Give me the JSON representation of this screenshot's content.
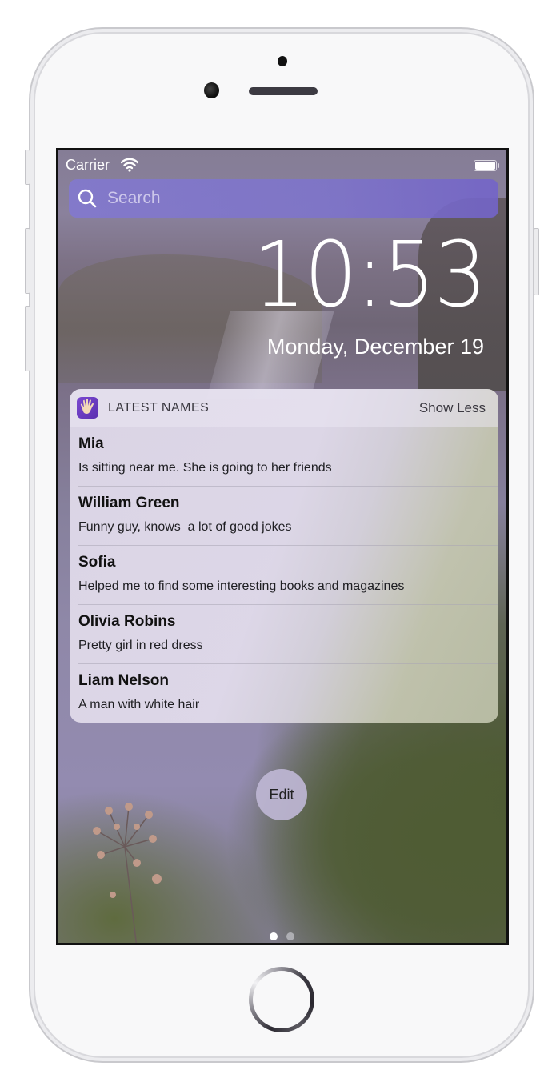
{
  "status_bar": {
    "carrier": "Carrier",
    "wifi_icon": "wifi-icon",
    "battery_icon": "battery-full-icon"
  },
  "search": {
    "placeholder": "Search",
    "icon": "search-icon"
  },
  "lock_screen": {
    "time": "10:53",
    "date": "Monday, December 19"
  },
  "widget": {
    "title": "LATEST NAMES",
    "app_icon": "hand-icon",
    "toggle_label": "Show Less",
    "items": [
      {
        "name": "Mia",
        "description": "Is sitting near me. She is going to her friends"
      },
      {
        "name": "William Green",
        "description": "Funny guy, knows  a lot of good jokes"
      },
      {
        "name": "Sofia",
        "description": "Helped me to find some interesting books and magazines"
      },
      {
        "name": "Olivia Robins",
        "description": "Pretty girl in red dress"
      },
      {
        "name": "Liam Nelson",
        "description": "A man with white hair"
      }
    ]
  },
  "edit_button": {
    "label": "Edit"
  },
  "page_indicator": {
    "current": 1,
    "total": 2
  },
  "colors": {
    "widget_background": "#e0daea",
    "search_bar": "#7f73cf",
    "app_icon": "#6a3cc0"
  }
}
